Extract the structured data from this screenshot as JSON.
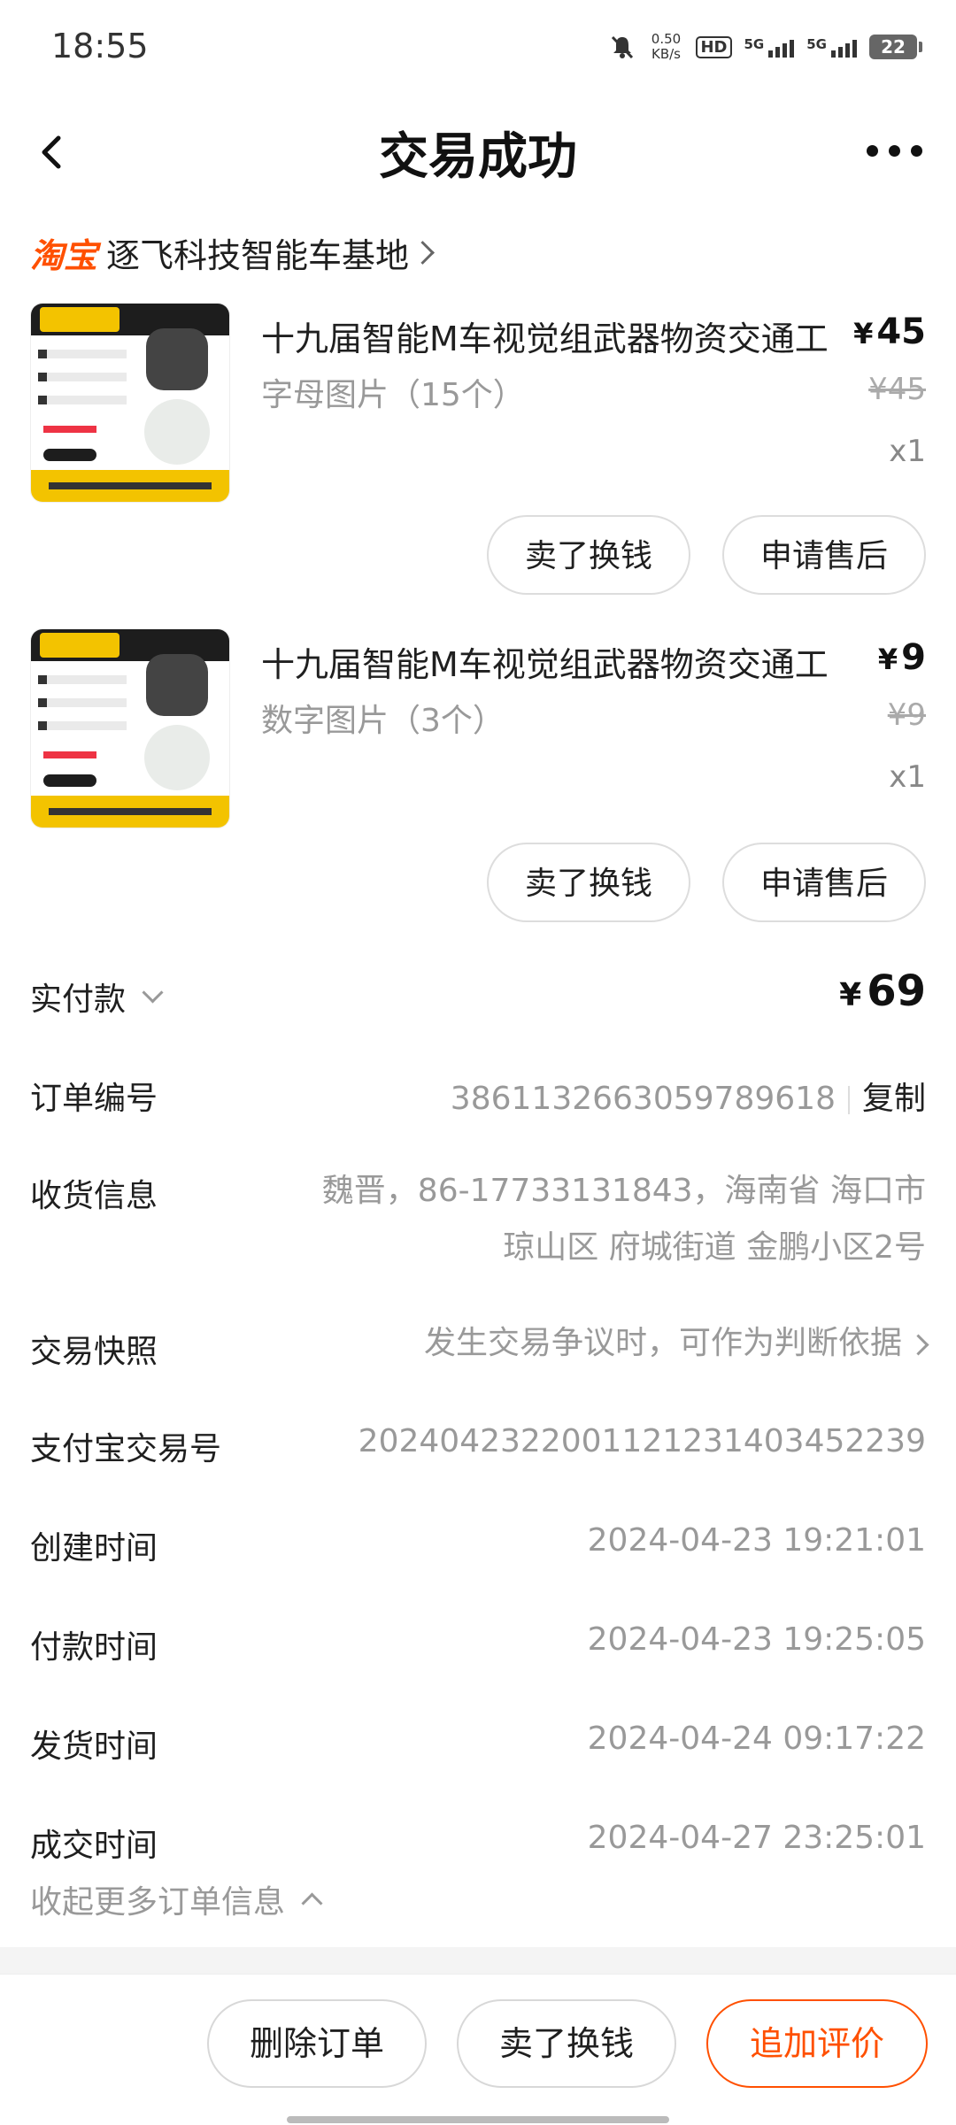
{
  "status_bar": {
    "time": "18:55",
    "net_speed_value": "0.50",
    "net_speed_unit": "KB/s",
    "hd_label": "HD",
    "sim1": "5G",
    "sim2": "5G",
    "battery": "22"
  },
  "header": {
    "title": "交易成功",
    "back_icon": "chevron-left-icon",
    "more_icon": "more-dots-icon"
  },
  "shop": {
    "platform": "淘宝",
    "name": "逐飞科技智能车基地"
  },
  "products": [
    {
      "title": "十九届智能M车视觉组武器物资交通工具",
      "sku": "字母图片（15个）",
      "price_symbol": "¥",
      "price": "45",
      "original_price": "¥45",
      "quantity": "x1",
      "action_resell": "卖了换钱",
      "action_aftersale": "申请售后"
    },
    {
      "title": "十九届智能M车视觉组武器物资交通工具",
      "sku": "数字图片（3个）",
      "price_symbol": "¥",
      "price": "9",
      "original_price": "¥9",
      "quantity": "x1",
      "action_resell": "卖了换钱",
      "action_aftersale": "申请售后"
    }
  ],
  "payment": {
    "label": "实付款",
    "symbol": "¥",
    "amount": "69"
  },
  "order_info": {
    "order_no_label": "订单编号",
    "order_no": "3861132663059789618",
    "copy_label": "复制",
    "address_label": "收货信息",
    "address_line1": "魏晋，86-17733131843，海南省 海口市",
    "address_line2": "琼山区 府城街道 金鹏小区2号",
    "snapshot_label": "交易快照",
    "snapshot_value": "发生交易争议时，可作为判断依据",
    "alipay_label": "支付宝交易号",
    "alipay_no": "2024042322001121231403452239",
    "created_label": "创建时间",
    "created": "2024-04-23 19:21:01",
    "paid_label": "付款时间",
    "paid": "2024-04-23 19:25:05",
    "shipped_label": "发货时间",
    "shipped": "2024-04-24 09:17:22",
    "completed_label": "成交时间",
    "completed": "2024-04-27 23:25:01",
    "collapse_label": "收起更多订单信息"
  },
  "bottom_bar": {
    "delete": "删除订单",
    "resell": "卖了换钱",
    "review": "追加评价"
  },
  "colors": {
    "accent": "#ff5000",
    "text": "#1f1f1f",
    "muted": "#999999"
  }
}
